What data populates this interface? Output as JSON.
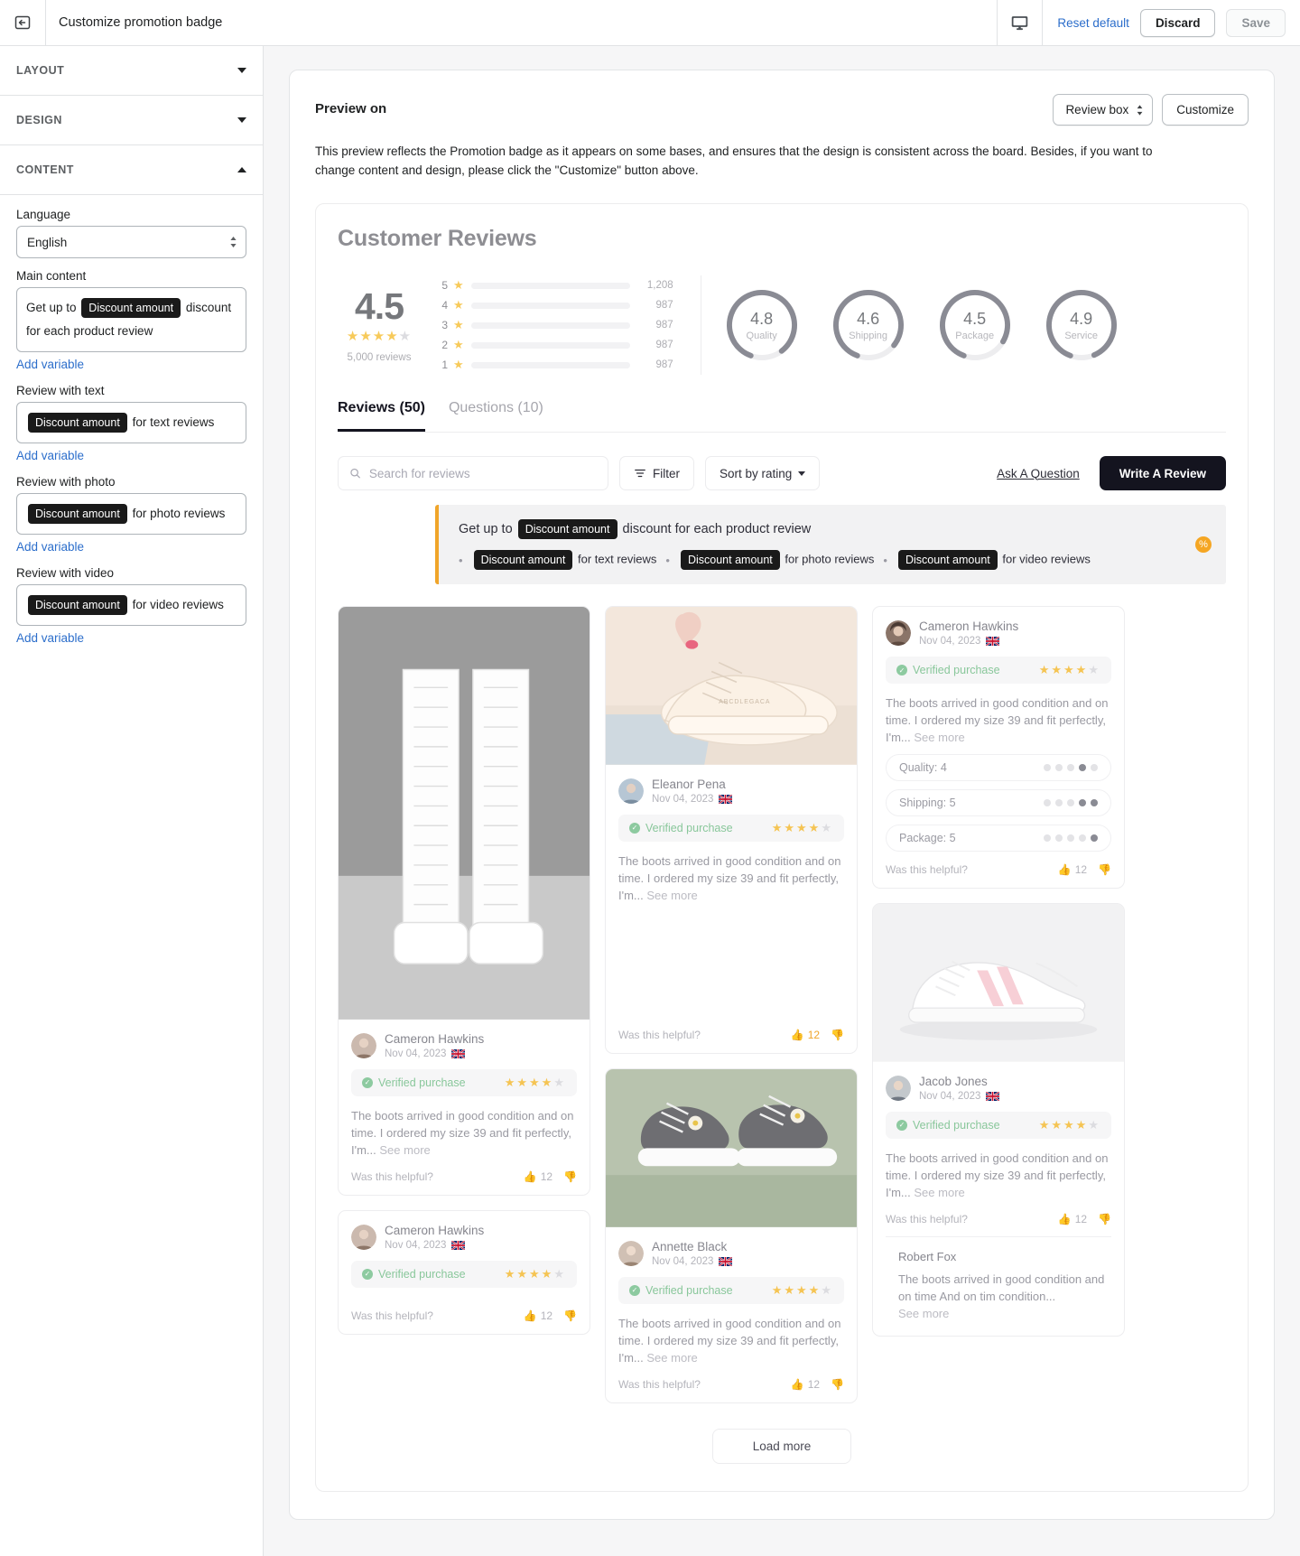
{
  "topbar": {
    "back_icon": "collapse-panel-icon",
    "title": "Customize promotion badge",
    "device_icon": "desktop-icon",
    "reset_label": "Reset default",
    "discard_label": "Discard",
    "save_label": "Save"
  },
  "sidebar": {
    "sections": [
      {
        "label": "LAYOUT",
        "expanded": false
      },
      {
        "label": "DESIGN",
        "expanded": false
      },
      {
        "label": "CONTENT",
        "expanded": true
      }
    ],
    "language_label": "Language",
    "language_value": "English",
    "language_options": [
      "English"
    ],
    "fields": [
      {
        "label": "Main content",
        "parts": [
          {
            "type": "text",
            "value": "Get up to "
          },
          {
            "type": "var",
            "value": "Discount amount"
          },
          {
            "type": "text",
            "value": " discount for each product review"
          }
        ],
        "add_variable": "Add variable"
      },
      {
        "label": "Review with text",
        "parts": [
          {
            "type": "var",
            "value": "Discount amount"
          },
          {
            "type": "text",
            "value": " for text reviews"
          }
        ],
        "add_variable": "Add variable"
      },
      {
        "label": "Review with photo",
        "parts": [
          {
            "type": "var",
            "value": "Discount amount"
          },
          {
            "type": "text",
            "value": " for photo reviews"
          }
        ],
        "add_variable": "Add variable"
      },
      {
        "label": "Review with video",
        "parts": [
          {
            "type": "var",
            "value": "Discount amount"
          },
          {
            "type": "text",
            "value": " for video reviews"
          }
        ],
        "add_variable": "Add variable"
      }
    ]
  },
  "preview": {
    "heading": "Preview on",
    "select_value": "Review box",
    "select_options": [
      "Review box"
    ],
    "customize_label": "Customize",
    "description": "This preview reflects the Promotion badge as it appears on some bases, and ensures that the design is consistent across the board. Besides, if you want to change content and design, please click the \"Customize\" button above."
  },
  "widget": {
    "title": "Customer Reviews",
    "summary": {
      "average": "4.5",
      "stars_filled": 3,
      "stars_half": 1,
      "stars_total": 5,
      "total_reviews": "5,000 reviews",
      "breakdown": [
        {
          "stars": "5",
          "count": "1,208",
          "percent": 78
        },
        {
          "stars": "4",
          "count": "987",
          "percent": 58
        },
        {
          "stars": "3",
          "count": "987",
          "percent": 41
        },
        {
          "stars": "2",
          "count": "987",
          "percent": 26
        },
        {
          "stars": "1",
          "count": "987",
          "percent": 14
        }
      ],
      "attributes": [
        {
          "value": "4.8",
          "label": "Quality",
          "percent": 84
        },
        {
          "value": "4.6",
          "label": "Shipping",
          "percent": 80
        },
        {
          "value": "4.5",
          "label": "Package",
          "percent": 78
        },
        {
          "value": "4.9",
          "label": "Service",
          "percent": 88
        }
      ]
    },
    "tabs": [
      {
        "label": "Reviews (50)",
        "active": true
      },
      {
        "label": "Questions (10)",
        "active": false
      }
    ],
    "toolbar": {
      "search_placeholder": "Search for reviews",
      "search_value": "",
      "search_icon": "search-icon",
      "filter_label": "Filter",
      "filter_icon": "filter-icon",
      "sort_label": "Sort by rating",
      "sort_icon": "chevron-down-icon",
      "ask_label": "Ask A Question",
      "write_label": "Write A Review"
    },
    "promo": {
      "main_prefix": "Get up to ",
      "main_var": "Discount amount",
      "main_suffix": " discount for each product review",
      "items": [
        {
          "var": "Discount amount",
          "text": " for text reviews"
        },
        {
          "var": "Discount amount",
          "text": " for photo reviews"
        },
        {
          "var": "Discount amount",
          "text": " for video reviews"
        }
      ],
      "accent_color": "#f0a52a",
      "badge_icon": "discount-tag-icon"
    },
    "reviews": {
      "col1": [
        {
          "photo": "white-knee-high-boots",
          "name": "Cameron Hawkins",
          "date": "Nov 04, 2023",
          "flag": "uk-flag",
          "verified": "Verified purchase",
          "rating": 4,
          "text": "The boots arrived in good condition and on time. I ordered my size 39 and fit perfectly, I'm...",
          "see_more": "See more",
          "helpful": "Was this helpful?",
          "helpful_count": "12"
        },
        {
          "name": "Cameron Hawkins",
          "date": "Nov 04, 2023",
          "flag": "uk-flag",
          "verified": "Verified purchase",
          "rating": 4,
          "helpful": "Was this helpful?",
          "helpful_count": "12"
        }
      ],
      "col2": [
        {
          "photo": "beige-chunky-sneaker",
          "name": "Eleanor Pena",
          "date": "Nov 04, 2023",
          "flag": "uk-flag",
          "verified": "Verified purchase",
          "rating": 4,
          "text": "The boots arrived in good condition and on time. I ordered my size 39 and fit perfectly, I'm...",
          "see_more": "See more",
          "helpful": "Was this helpful?",
          "helpful_count": "12"
        },
        {
          "photo": "grey-daisy-sneakers",
          "name": "Annette Black",
          "date": "Nov 04, 2023",
          "flag": "uk-flag",
          "verified": "Verified purchase",
          "rating": 4,
          "text": "The boots arrived in good condition and on time. I ordered my size 39 and fit perfectly, I'm...",
          "see_more": "See more",
          "helpful": "Was this helpful?",
          "helpful_count": "12"
        }
      ],
      "col3": [
        {
          "name": "Cameron Hawkins",
          "date": "Nov 04, 2023",
          "flag": "uk-flag",
          "verified": "Verified purchase",
          "rating": 4,
          "text": "The boots arrived in good condition and on time. I ordered my size 39 and fit perfectly, I'm...",
          "see_more": "See more",
          "attributes": [
            {
              "label": "Quality: 4",
              "filled": 4
            },
            {
              "label": "Shipping: 5",
              "filled": 5
            },
            {
              "label": "Package: 5",
              "filled": 5
            }
          ],
          "helpful": "Was this helpful?",
          "helpful_count": "12"
        },
        {
          "photo": "white-pink-stripe-sneaker",
          "name": "Jacob Jones",
          "date": "Nov 04, 2023",
          "flag": "uk-flag",
          "verified": "Verified purchase",
          "rating": 4,
          "text": "The boots arrived in good condition and on time. I ordered my size 39 and fit perfectly, I'm...",
          "see_more": "See more",
          "helpful": "Was this helpful?",
          "helpful_count": "12",
          "reply": {
            "name": "Robert Fox",
            "text": "The boots arrived in good condition and on time And on tim condition...",
            "see_more": "See more"
          }
        }
      ]
    },
    "load_more": "Load more"
  }
}
